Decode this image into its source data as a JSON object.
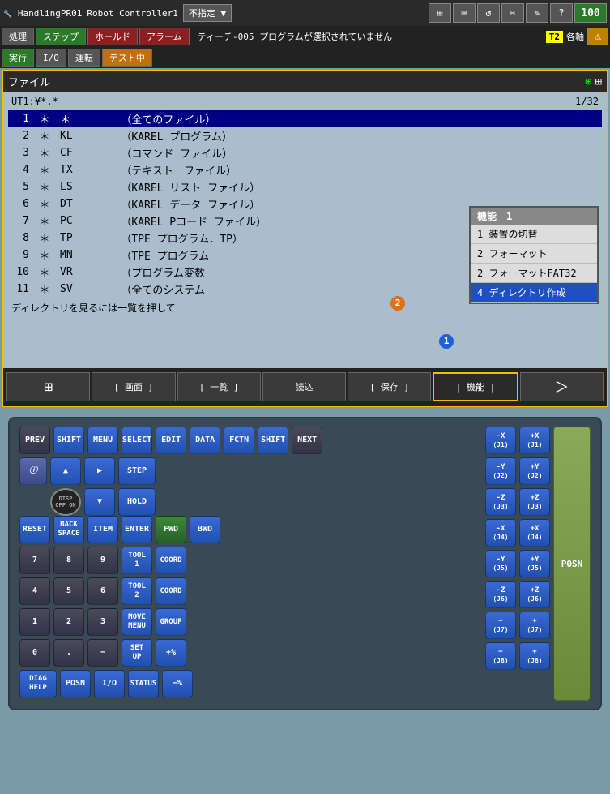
{
  "topbar": {
    "logo": "HandlingPR01",
    "controller": "Robot Controller1",
    "dropdown": "不指定",
    "icons": [
      "⬛",
      "⌨",
      "↺",
      "✂",
      "✎",
      "?",
      "×"
    ],
    "pct": "100"
  },
  "menubar": {
    "btn1": "処理",
    "btn2": "ステップ",
    "btn3": "ホールド",
    "btn4": "アラーム",
    "status": "ティーチ-005 プログラムが選択されていません",
    "t2": "T2",
    "axes": "各軸",
    "btn5": "実行",
    "btn6": "I/O",
    "btn7": "運転",
    "btn8": "テスト中"
  },
  "filebar": {
    "title": "ファイル"
  },
  "fileheader": {
    "path": "UT1:¥*.* ",
    "page": "1/32"
  },
  "filelist": {
    "rows": [
      {
        "num": "1",
        "star": "＊",
        "type": "＊",
        "desc": "（全てのファイル）"
      },
      {
        "num": "2",
        "star": "＊",
        "type": "KL",
        "desc": "（KAREL プログラム）"
      },
      {
        "num": "3",
        "star": "＊",
        "type": "CF",
        "desc": "（コマンド ファイル）"
      },
      {
        "num": "4",
        "star": "＊",
        "type": "TX",
        "desc": "（テキスト　ファイル）"
      },
      {
        "num": "5",
        "star": "＊",
        "type": "LS",
        "desc": "（KAREL リスト ファイル）"
      },
      {
        "num": "6",
        "star": "＊",
        "type": "DT",
        "desc": "（KAREL データ ファイル）"
      },
      {
        "num": "7",
        "star": "＊",
        "type": "PC",
        "desc": "（KAREL Pコード ファイル）"
      },
      {
        "num": "8",
        "star": "＊",
        "type": "TP",
        "desc": "（TPE プログラム．TP）"
      },
      {
        "num": "9",
        "star": "＊",
        "type": "MN",
        "desc": "（TPE プログラム"
      },
      {
        "num": "10",
        "star": "＊",
        "type": "VR",
        "desc": "（プログラム変数"
      },
      {
        "num": "11",
        "star": "＊",
        "type": "SV",
        "desc": "（全てのシステム"
      }
    ],
    "status": "ディレクトリを見るには一覧を押して"
  },
  "popup": {
    "title": "機能　1",
    "items": [
      {
        "num": "1",
        "label": "装置の切替"
      },
      {
        "num": "2",
        "label": "フォーマット"
      },
      {
        "num": "2",
        "label": "フォーマットFAT32"
      },
      {
        "num": "4",
        "label": "ディレクトリ作成",
        "highlighted": true
      }
    ]
  },
  "funcbar": {
    "grid": "⊞",
    "btn1": "[ 画面 ]",
    "btn2": "[ 一覧 ]",
    "btn3": "読込",
    "btn4": "[ 保存 ]",
    "btn5": "| 機能 |",
    "nav": "＞"
  },
  "keyboard": {
    "row1": [
      {
        "label": "PREV",
        "type": "dark"
      },
      {
        "label": "SHIFT",
        "type": "blue"
      },
      {
        "label": "MENU",
        "type": "blue"
      },
      {
        "label": "SELECT",
        "type": "blue"
      },
      {
        "label": "EDIT",
        "type": "blue"
      },
      {
        "label": "DATA",
        "type": "blue"
      },
      {
        "label": "FCTN",
        "type": "blue"
      },
      {
        "label": "SHIFT",
        "type": "blue"
      },
      {
        "label": "NEXT",
        "type": "dark"
      }
    ],
    "row_info": {
      "label": "ｉ",
      "type": "info"
    },
    "row_disp": {
      "label": "",
      "type": "disp-off"
    },
    "row2_right": [
      {
        "label": "STEP",
        "type": "blue"
      }
    ],
    "row3": [
      {
        "label": "↑",
        "type": "blue"
      },
      {
        "label": "→",
        "type": "blue"
      },
      {
        "label": "HOLD",
        "type": "blue"
      }
    ],
    "row4": [
      {
        "label": "↓",
        "type": "blue"
      },
      {
        "label": "FWD",
        "type": "green"
      }
    ],
    "row5": [
      {
        "label": "RESET",
        "type": "blue"
      },
      {
        "label": "BACK\nSPACE",
        "type": "blue"
      },
      {
        "label": "ITEM",
        "type": "blue"
      },
      {
        "label": "ENTER",
        "type": "blue"
      },
      {
        "label": "BWD",
        "type": "blue"
      }
    ],
    "numrow1": [
      {
        "label": "7",
        "type": "dark"
      },
      {
        "label": "8",
        "type": "dark"
      },
      {
        "label": "9",
        "type": "dark"
      },
      {
        "label": "TOOL\n1",
        "type": "blue"
      },
      {
        "label": "COORD",
        "type": "blue"
      }
    ],
    "numrow2": [
      {
        "label": "4",
        "type": "dark"
      },
      {
        "label": "5",
        "type": "dark"
      },
      {
        "label": "6",
        "type": "dark"
      },
      {
        "label": "TOOL\n2",
        "type": "blue"
      },
      {
        "label": "COORD",
        "type": "blue"
      }
    ],
    "numrow3": [
      {
        "label": "1",
        "type": "dark"
      },
      {
        "label": "2",
        "type": "dark"
      },
      {
        "label": "3",
        "type": "dark"
      },
      {
        "label": "MOVE\nMENU",
        "type": "blue"
      },
      {
        "label": "GROUP",
        "type": "blue"
      }
    ],
    "numrow4": [
      {
        "label": "0",
        "type": "dark"
      },
      {
        "label": ".",
        "type": "dark"
      },
      {
        "label": "−",
        "type": "dark"
      },
      {
        "label": "SET\nUP",
        "type": "blue"
      },
      {
        "label": "+%",
        "type": "blue"
      }
    ],
    "botrow": [
      {
        "label": "DIAG\nHELP",
        "type": "blue"
      },
      {
        "label": "POSN",
        "type": "blue"
      },
      {
        "label": "I/O",
        "type": "blue"
      },
      {
        "label": "STATUS",
        "type": "blue"
      },
      {
        "label": "−%",
        "type": "blue"
      }
    ],
    "axiskeys": [
      [
        {
          "label": "-X\n(J1)",
          "type": "blue"
        },
        {
          "label": "+X\n(J1)",
          "type": "blue"
        }
      ],
      [
        {
          "label": "-Y\n(J2)",
          "type": "blue"
        },
        {
          "label": "+Y\n(J2)",
          "type": "blue"
        }
      ],
      [
        {
          "label": "-Z\n(J3)",
          "type": "blue"
        },
        {
          "label": "+Z\n(J3)",
          "type": "blue"
        }
      ],
      [
        {
          "label": "-X\n(J4)",
          "type": "blue"
        },
        {
          "label": "+X\n(J4)",
          "type": "blue"
        }
      ],
      [
        {
          "label": "-Y\n(J5)",
          "type": "blue"
        },
        {
          "label": "+Y\n(J5)",
          "type": "blue"
        }
      ],
      [
        {
          "label": "-Z\n(J6)",
          "type": "blue"
        },
        {
          "label": "+Z\n(J6)",
          "type": "blue"
        }
      ],
      [
        {
          "label": "−\n(J7)",
          "type": "blue"
        },
        {
          "label": "+\n(J7)",
          "type": "blue"
        }
      ],
      [
        {
          "label": "−\n(J8)",
          "type": "blue"
        },
        {
          "label": "+\n(J8)",
          "type": "blue"
        }
      ]
    ],
    "posn_label": "POSN"
  }
}
